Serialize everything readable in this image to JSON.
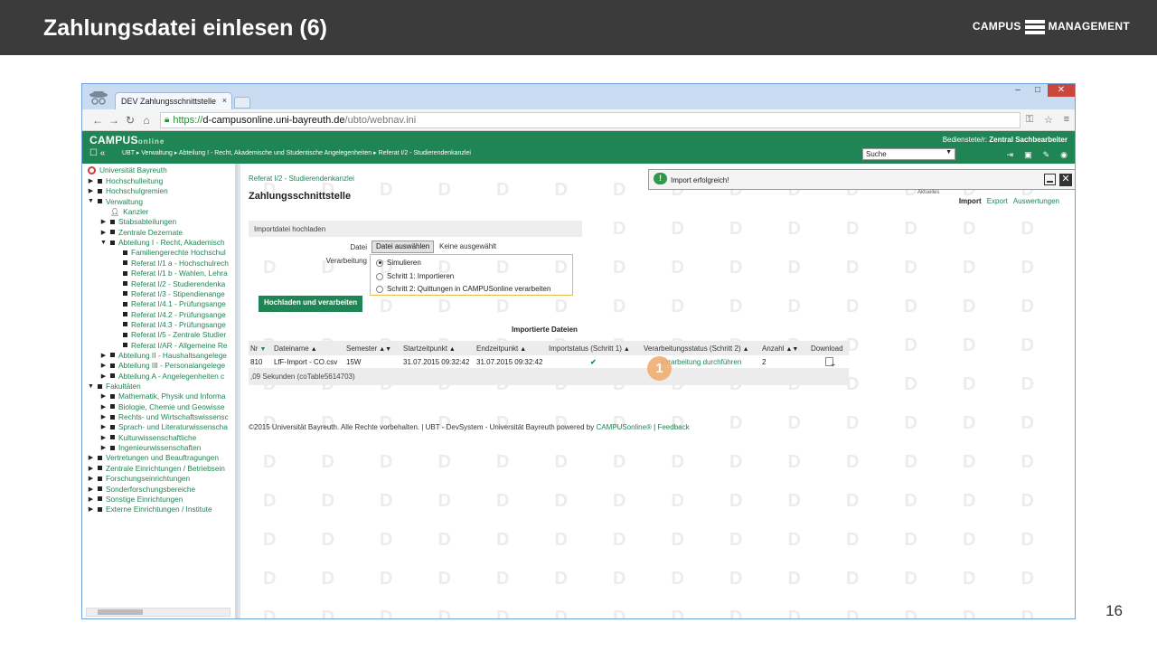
{
  "slide": {
    "title": "Zahlungsdatei einlesen (6)",
    "brand_left": "CAMPUS",
    "brand_right": "MANAGEMENT",
    "page_number": "16"
  },
  "browser": {
    "tab_title": "DEV Zahlungsschnittstelle",
    "tab_close": "×",
    "window_controls": [
      "–",
      "□",
      "✕"
    ],
    "url_scheme": "https://",
    "url_host": "d-campusonline.uni-bayreuth.de",
    "url_path": "/ubto/webnav.ini"
  },
  "co": {
    "logo": "CAMPUS",
    "logo_suffix": "online",
    "breadcrumb": "UBT  ▸  Verwaltung  ▸  Abteilung I - Recht, Akademische und Studentische Angelegenheiten  ▸  Referat I/2 - Studierendenkanzlei",
    "user_label": "Bedienstete/r:",
    "user_name": "Zentral Sachbearbeiter",
    "search_value": "Suche",
    "search_arrow": "▼"
  },
  "sidebar": {
    "root": "Universität Bayreuth",
    "items": [
      {
        "label": "Hochschulleitung",
        "toggle": "▶"
      },
      {
        "label": "Hochschulgremien",
        "toggle": "▶"
      },
      {
        "label": "Verwaltung",
        "toggle": "▼"
      },
      {
        "label": "Kanzler",
        "toggle": ""
      },
      {
        "label": "Stabsabteilungen",
        "toggle": "▶"
      },
      {
        "label": "Zentrale Dezernate",
        "toggle": "▶"
      },
      {
        "label": "Abteilung I - Recht, Akademisch",
        "toggle": "▼"
      },
      {
        "label": "Familiengerechte Hochschul",
        "toggle": ""
      },
      {
        "label": "Referat I/1 a - Hochschulrech",
        "toggle": ""
      },
      {
        "label": "Referat I/1 b - Wahlen, Lehra",
        "toggle": ""
      },
      {
        "label": "Referat I/2 - Studierendenka",
        "toggle": ""
      },
      {
        "label": "Referat I/3 - Stipendienange",
        "toggle": ""
      },
      {
        "label": "Referat I/4.1 - Prüfungsange",
        "toggle": ""
      },
      {
        "label": "Referat I/4.2 - Prüfungsange",
        "toggle": ""
      },
      {
        "label": "Referat I/4.3 - Prüfungsange",
        "toggle": ""
      },
      {
        "label": "Referat I/5 - Zentrale Studier",
        "toggle": ""
      },
      {
        "label": "Referat I/AR - Allgemeine Re",
        "toggle": ""
      },
      {
        "label": "Abteilung II - Haushaltsangelege",
        "toggle": "▶"
      },
      {
        "label": "Abteilung III - Personalangelege",
        "toggle": "▶"
      },
      {
        "label": "Abteilung A - Angelegenheiten c",
        "toggle": "▶"
      },
      {
        "label": "Fakultäten",
        "toggle": "▼"
      },
      {
        "label": "Mathematik, Physik und Informa",
        "toggle": "▶"
      },
      {
        "label": "Biologie, Chemie und Geowisse",
        "toggle": "▶"
      },
      {
        "label": "Rechts- und Wirtschaftswissensc",
        "toggle": "▶"
      },
      {
        "label": "Sprach- und Literaturwissenscha",
        "toggle": "▶"
      },
      {
        "label": "Kulturwissenschaftliche",
        "toggle": "▶"
      },
      {
        "label": "Ingenieurwissenschaften",
        "toggle": "▶"
      },
      {
        "label": "Vertretungen und Beauftragungen",
        "toggle": "▶"
      },
      {
        "label": "Zentrale Einrichtungen / Betriebsein",
        "toggle": "▶"
      },
      {
        "label": "Forschungseinrichtungen",
        "toggle": "▶"
      },
      {
        "label": "Sonderforschungsbereiche",
        "toggle": "▶"
      },
      {
        "label": "Sonstige Einrichtungen",
        "toggle": "▶"
      },
      {
        "label": "Externe Einrichtungen / Institute",
        "toggle": "▶"
      }
    ]
  },
  "content": {
    "ref_link": "Referat I/2 - Studierendenkanzlei",
    "page_title": "Zahlungsschnittstelle",
    "tabs": [
      "Import",
      "Export",
      "Auswertungen"
    ],
    "notice": {
      "text": "Import erfolgreich!",
      "icon": "!",
      "sub": "Aktuelles"
    },
    "upload_heading": "Importdatei hochladen",
    "datei_label": "Datei",
    "datei_button": "Datei auswählen",
    "datei_status": "Keine ausgewählt",
    "verarbeitung_label": "Verarbeitung",
    "radio_options": [
      "Simulieren",
      "Schritt 1: Importieren",
      "Schritt 2: Quittungen in CAMPUSonline verarbeiten"
    ],
    "submit_button": "Hochladen und verarbeiten",
    "table_title": "Importierte Dateien",
    "columns": [
      "Nr",
      "Dateiname",
      "Semester",
      "Startzeitpunkt",
      "Endzeitpunkt",
      "Importstatus (Schritt 1)",
      "Verarbeitungsstatus (Schritt 2)",
      "Anzahl",
      "Download"
    ],
    "row": {
      "nr": "810",
      "dateiname": "LfF-Import - CO.csv",
      "semester": "15W",
      "start": "31.07.2015 09:32:42",
      "ende": "31.07.2015 09:32:42",
      "importstatus": "✔",
      "verarbeitung": "Verarbeitung durchführen",
      "anzahl": "2"
    },
    "table_footer": ",09 Sekunden (coTable5614703)",
    "marker": "1",
    "footer_text": "©2015 Universität Bayreuth. Alle Rechte vorbehalten. | UBT - DevSystem - Universität Bayreuth powered by ",
    "footer_link": "CAMPUSonline®",
    "footer_sep": " | ",
    "footer_feedback": "Feedback"
  }
}
